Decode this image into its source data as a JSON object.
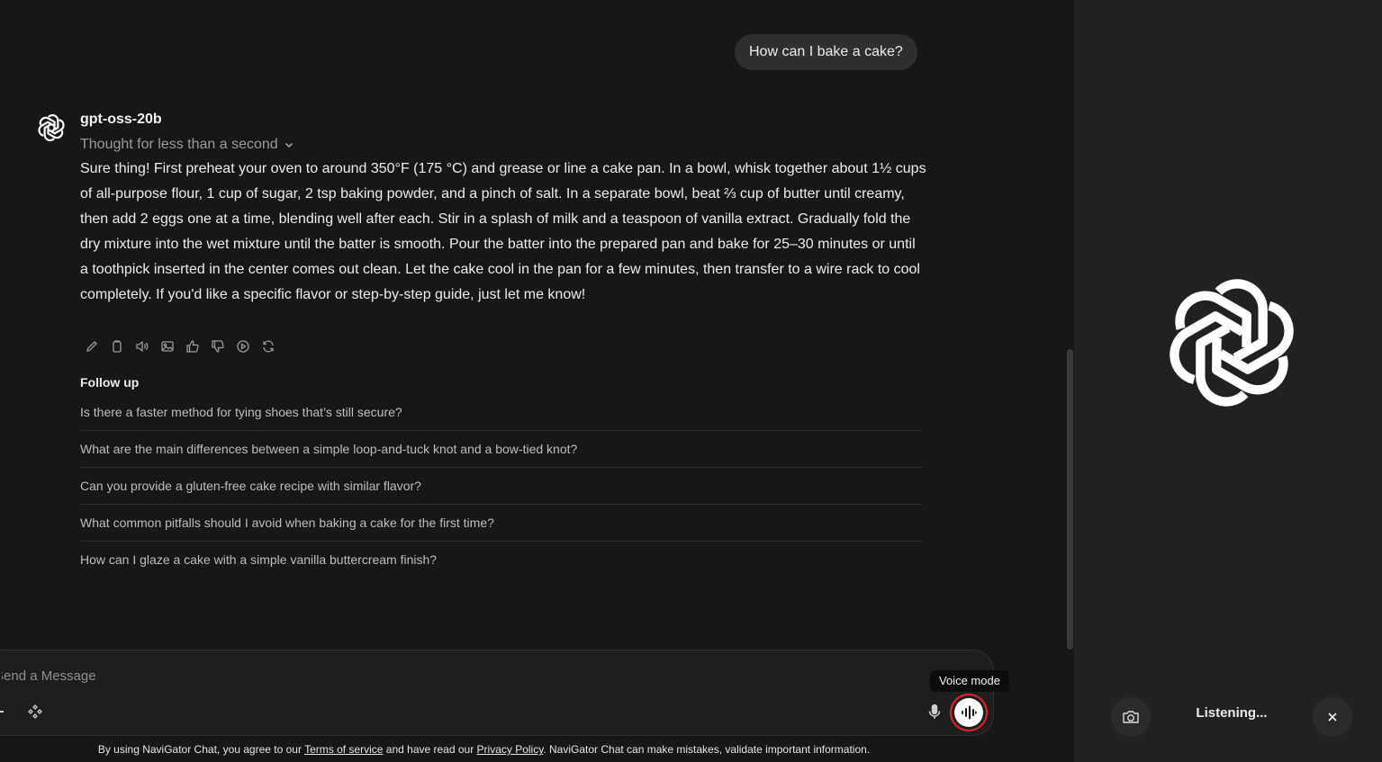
{
  "user_message": "How can I bake a cake?",
  "assistant": {
    "model_name": "gpt-oss-20b",
    "thought_label": "Thought for less than a second",
    "response": "Sure thing! First preheat your oven to around 350°F (175 °C) and grease or line a cake pan. In a bowl, whisk together about 1½ cups of all-purpose flour, 1 cup of sugar, 2 tsp baking powder, and a pinch of salt. In a separate bowl, beat ⅔ cup of butter until creamy, then add 2 eggs one at a time, blending well after each. Stir in a splash of milk and a teaspoon of vanilla extract. Gradually fold the dry mixture into the wet mixture until the batter is smooth. Pour the batter into the prepared pan and bake for 25–30 minutes or until a toothpick inserted in the center comes out clean. Let the cake cool in the pan for a few minutes, then transfer to a wire rack to cool completely. If you'd like a specific flavor or step-by-step guide, just let me know!",
    "actions": [
      "edit-icon",
      "copy-icon",
      "read-aloud-icon",
      "image-icon",
      "thumbs-up-icon",
      "thumbs-down-icon",
      "continue-icon",
      "regenerate-icon"
    ]
  },
  "follow_up": {
    "title": "Follow up",
    "items": [
      "Is there a faster method for tying shoes that’s still secure?",
      "What are the main differences between a simple loop-and-tuck knot and a bow-tied knot?",
      "Can you provide a gluten-free cake recipe with similar flavor?",
      "What common pitfalls should I avoid when baking a cake for the first time?",
      "How can I glaze a cake with a simple vanilla buttercream finish?"
    ]
  },
  "input": {
    "placeholder": "Send a Message",
    "value": ""
  },
  "tooltip": "Voice mode",
  "footer": {
    "prefix": "By using NaviGator Chat, you agree to our ",
    "terms": "Terms of service",
    "middle": " and have read our ",
    "privacy": "Privacy Policy",
    "suffix": ". NaviGator Chat can make mistakes, validate important information."
  },
  "voice_panel": {
    "status": "Listening..."
  },
  "colors": {
    "background": "#171717",
    "panel": "#212121",
    "user_bubble": "#2f2f2f",
    "voice_ring": "#e0262a"
  }
}
